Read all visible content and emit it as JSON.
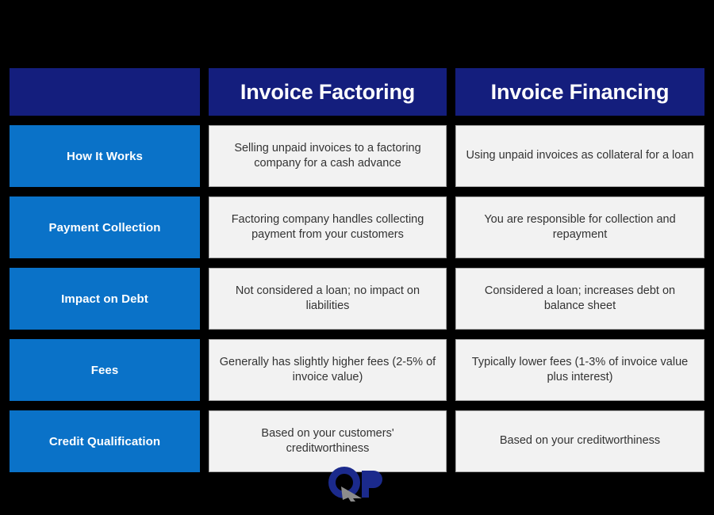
{
  "table": {
    "columns": [
      {
        "key": "feature",
        "label": ""
      },
      {
        "key": "factoring",
        "label": "Invoice Factoring"
      },
      {
        "key": "financing",
        "label": "Invoice Financing"
      }
    ],
    "rows": [
      {
        "label": "How It Works",
        "factoring": "Selling unpaid invoices to a factoring company for a cash advance",
        "financing": "Using unpaid invoices as collateral for a loan"
      },
      {
        "label": "Payment Collection",
        "factoring": "Factoring company handles collecting payment from your customers",
        "financing": "You are responsible for collection and repayment"
      },
      {
        "label": "Impact on Debt",
        "factoring": "Not considered a loan; no impact on liabilities",
        "financing": "Considered a loan; increases debt on balance sheet"
      },
      {
        "label": "Fees",
        "factoring": "Generally has slightly higher fees (2-5% of invoice value)",
        "financing": "Typically lower fees (1-3% of invoice value plus interest)"
      },
      {
        "label": "Credit Qualification",
        "factoring": "Based on your customers' creditworthiness",
        "financing": "Based on your creditworthiness"
      }
    ]
  },
  "logo": {
    "name": "qp-logo",
    "text": "QP",
    "navy": "#1B2A8C",
    "cursor_gray": "#8C8C8C"
  },
  "colors": {
    "background": "#000000",
    "header_navy": "#141E7D",
    "label_blue": "#0A72C8",
    "cell_background": "#F2F2F2",
    "cell_border": "#A9A9A9",
    "cell_text": "#333333",
    "header_text": "#FFFFFF"
  }
}
